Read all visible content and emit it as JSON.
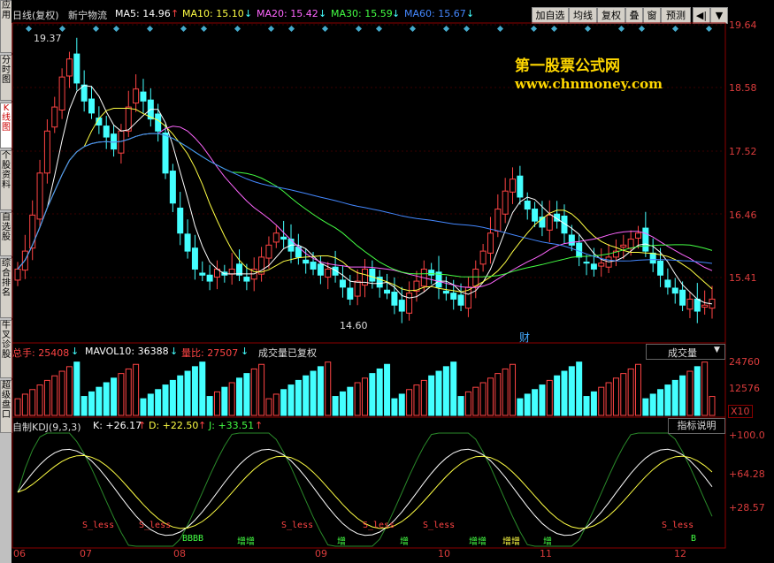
{
  "left_tabs": [
    {
      "label": "应用",
      "active": false
    },
    {
      "label": "分时图",
      "active": false
    },
    {
      "label": "K线图",
      "active": true
    },
    {
      "label": "个股资料",
      "active": false
    },
    {
      "label": "自选股",
      "active": false
    },
    {
      "label": "综合排名",
      "active": false
    },
    {
      "label": "牛叉诊股",
      "active": false
    },
    {
      "label": "超级盘口",
      "active": false
    }
  ],
  "header": {
    "period": "日线(复权)",
    "stock": "新宁物流",
    "ma5": "MA5: 14.96",
    "ma10": "MA10: 15.10",
    "ma20": "MA20: 15.42",
    "ma30": "MA30: 15.59",
    "ma60": "MA60: 15.67"
  },
  "toolbar": {
    "add": "加自选",
    "avg": "均线",
    "fq": "复权",
    "overlay": "叠",
    "window": "窗",
    "forecast": "预测",
    "back": "◀|"
  },
  "price_axis": [
    "19.64",
    "18.58",
    "17.52",
    "16.46",
    "15.41"
  ],
  "hi_label": "19.37",
  "lo_label": "14.60",
  "cai": "财",
  "watermark": {
    "line1": "第一股票公式网",
    "line2": "www.chnmoney.com"
  },
  "volume": {
    "title": "总手: 25408",
    "mavol": "MAVOL10: 36388",
    "liangbi": "量比: 27507",
    "note": "成交量已复权",
    "dropdown": "成交量",
    "axis": [
      "24760",
      "12576"
    ],
    "unit": "X10"
  },
  "kdj": {
    "title": "自制KDJ(9,3,3)",
    "k": "K: +26.17",
    "d": "D: +22.50",
    "j": "J: +33.51",
    "help": "指标说明",
    "axis": [
      "+100.0",
      "+64.28",
      "+28.57"
    ]
  },
  "signals": [
    {
      "text": "S_less",
      "color": "#ff4444"
    },
    {
      "text": "S_less",
      "color": "#ff4444"
    },
    {
      "text": "BBBB",
      "color": "#44ff44"
    },
    {
      "text": "增增",
      "color": "#44ff44"
    },
    {
      "text": "S_less",
      "color": "#ff4444"
    },
    {
      "text": "增",
      "color": "#44ff44"
    },
    {
      "text": "S_less",
      "color": "#ff4444"
    },
    {
      "text": "增",
      "color": "#44ff44"
    },
    {
      "text": "S_less",
      "color": "#ff4444"
    },
    {
      "text": "增增",
      "color": "#44ff44"
    },
    {
      "text": "增增",
      "color": "#ffff44"
    },
    {
      "text": "增",
      "color": "#44ff44"
    },
    {
      "text": "S_less",
      "color": "#ff4444"
    },
    {
      "text": "B",
      "color": "#44ff44"
    }
  ],
  "dates": [
    "06",
    "07",
    "08",
    "09",
    "10",
    "11",
    "12"
  ],
  "chart_data": {
    "type": "candlestick",
    "price_range": [
      14.4,
      19.7
    ],
    "closes": [
      15.6,
      15.9,
      16.5,
      17.2,
      17.9,
      18.3,
      18.8,
      19.1,
      18.7,
      18.4,
      18.2,
      18.0,
      17.8,
      17.6,
      17.9,
      18.3,
      18.6,
      18.4,
      18.1,
      17.9,
      17.2,
      16.7,
      16.2,
      15.9,
      15.6,
      15.5,
      15.4,
      15.6,
      15.5,
      15.6,
      15.5,
      15.4,
      15.6,
      15.8,
      16.0,
      16.2,
      16.1,
      15.9,
      15.8,
      15.7,
      15.6,
      15.5,
      15.6,
      15.5,
      15.3,
      15.1,
      15.4,
      15.6,
      15.4,
      15.3,
      15.2,
      15.0,
      14.9,
      15.2,
      15.4,
      15.6,
      15.5,
      15.3,
      15.2,
      15.1,
      15.0,
      15.3,
      15.6,
      15.9,
      16.2,
      16.6,
      16.9,
      17.1,
      16.8,
      16.6,
      16.4,
      16.3,
      16.5,
      16.4,
      16.2,
      16.0,
      15.8,
      15.7,
      15.6,
      15.7,
      15.8,
      15.9,
      16.0,
      16.1,
      16.2,
      15.9,
      15.7,
      15.5,
      15.3,
      15.2,
      15.0,
      15.1,
      14.9,
      15.0,
      15.1
    ],
    "volume_range": [
      0,
      28000
    ],
    "kdj_range": [
      0,
      105
    ]
  }
}
